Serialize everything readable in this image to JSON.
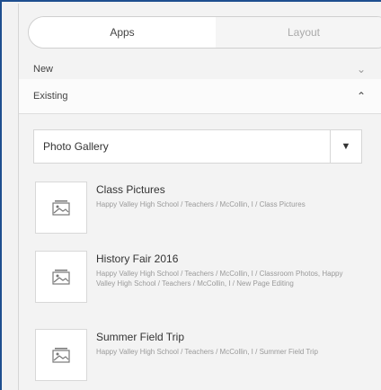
{
  "tabs": {
    "apps": "Apps",
    "layout": "Layout"
  },
  "sections": {
    "new": "New",
    "existing": "Existing"
  },
  "dropdown": {
    "selected": "Photo Gallery"
  },
  "items": [
    {
      "title": "Class Pictures",
      "path": "Happy Valley High School / Teachers / McCollin, I / Class Pictures"
    },
    {
      "title": "History Fair 2016",
      "path": "Happy Valley High School / Teachers / McCollin, I / Classroom Photos, Happy Valley High School / Teachers / McCollin, I / New Page Editing"
    },
    {
      "title": "Summer Field Trip",
      "path": "Happy Valley High School / Teachers / McCollin, I / Summer Field Trip"
    }
  ]
}
